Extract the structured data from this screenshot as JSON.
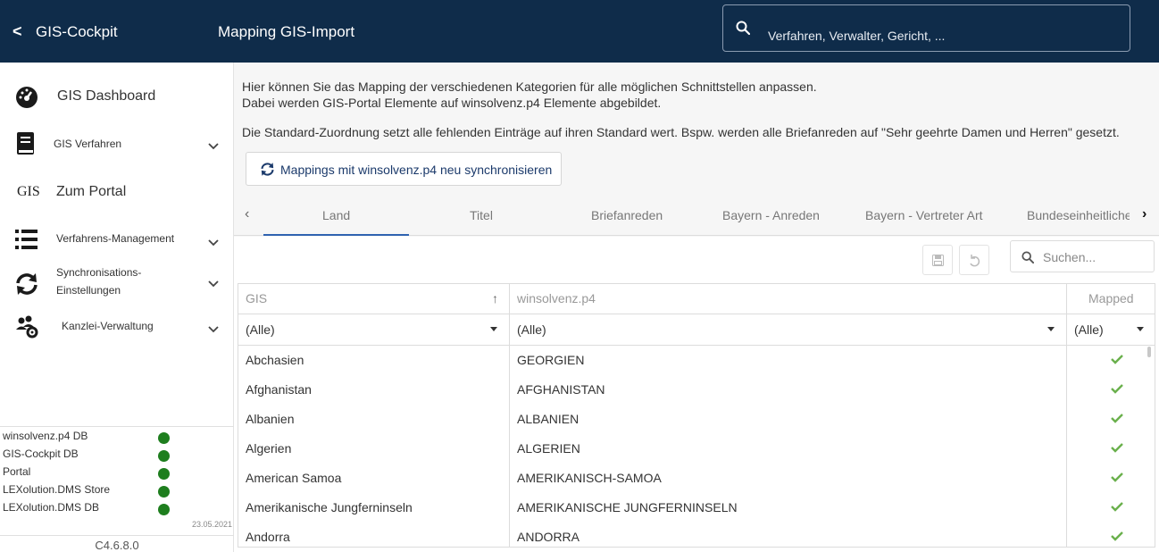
{
  "header": {
    "back_glyph": "<",
    "app_title": "GIS-Cockpit",
    "page_title": "Mapping GIS-Import",
    "search_placeholder": "Verfahren, Verwalter, Gericht, ..."
  },
  "sidebar": {
    "items": [
      {
        "icon": "dashboard-gauge-icon",
        "label": "GIS Dashboard"
      },
      {
        "icon": "book-icon",
        "label": "GIS Verfahren",
        "expandable": true
      },
      {
        "icon": "gis-text-logo",
        "icon_text": "GIS",
        "label": "Zum Portal"
      },
      {
        "icon": "list-icon",
        "label": "Verfahrens-Management",
        "expandable": true
      },
      {
        "icon": "sync-icon",
        "label": "Synchronisations-Einstellungen",
        "label_line1": "Synchronisations-",
        "label_line2": "Einstellungen",
        "expandable": true
      },
      {
        "icon": "users-gear-icon",
        "label": "Kanzlei-Verwaltung",
        "expandable": true
      }
    ],
    "status": [
      {
        "label": "winsolvenz.p4 DB",
        "status": "online"
      },
      {
        "label": "GIS-Cockpit DB",
        "status": "online"
      },
      {
        "label": "Portal",
        "status": "online"
      },
      {
        "label": "LEXolution.DMS Store",
        "status": "online"
      },
      {
        "label": "LEXolution.DMS DB",
        "status": "online"
      }
    ],
    "status_date": "23.05.2021",
    "version": "C4.6.8.0"
  },
  "main": {
    "intro_line1": "Hier können Sie das Mapping der verschiedenen Kategorien für alle möglichen Schnittstellen anpassen.",
    "intro_line2": "Dabei werden GIS-Portal Elemente auf winsolvenz.p4 Elemente abgebildet.",
    "intro_line3": "Die Standard-Zuordnung setzt alle fehlenden Einträge auf ihren Standard wert. Bspw. werden alle Briefanreden auf \"Sehr geehrte Damen und Herren\" gesetzt.",
    "sync_button": "Mappings mit winsolvenz.p4 neu synchronisieren",
    "tabs": [
      "Land",
      "Titel",
      "Briefanreden",
      "Bayern - Anreden",
      "Bayern - Vertreter Art",
      "Bundeseinheitliche"
    ],
    "active_tab": "Land",
    "grid_search_placeholder": "Suchen...",
    "table": {
      "columns": [
        "GIS",
        "winsolvenz.p4",
        "Mapped"
      ],
      "sort_indicator": "↑",
      "filters": [
        "(Alle)",
        "(Alle)",
        "(Alle)"
      ],
      "rows": [
        {
          "gis": "Abchasien",
          "wp4": "GEORGIEN",
          "mapped": true
        },
        {
          "gis": "Afghanistan",
          "wp4": "AFGHANISTAN",
          "mapped": true
        },
        {
          "gis": "Albanien",
          "wp4": "ALBANIEN",
          "mapped": true
        },
        {
          "gis": "Algerien",
          "wp4": "ALGERIEN",
          "mapped": true
        },
        {
          "gis": "American Samoa",
          "wp4": "AMERIKANISCH-SAMOA",
          "mapped": true
        },
        {
          "gis": "Amerikanische Jungferninseln",
          "wp4": "AMERIKANISCHE JUNGFERNINSELN",
          "mapped": true
        },
        {
          "gis": "Andorra",
          "wp4": "ANDORRA",
          "mapped": true
        }
      ]
    }
  },
  "colors": {
    "header_bg": "#0f2c4a",
    "accent": "#2f63b0",
    "status_ok": "#1e7e1e",
    "check": "#6ab04c"
  }
}
